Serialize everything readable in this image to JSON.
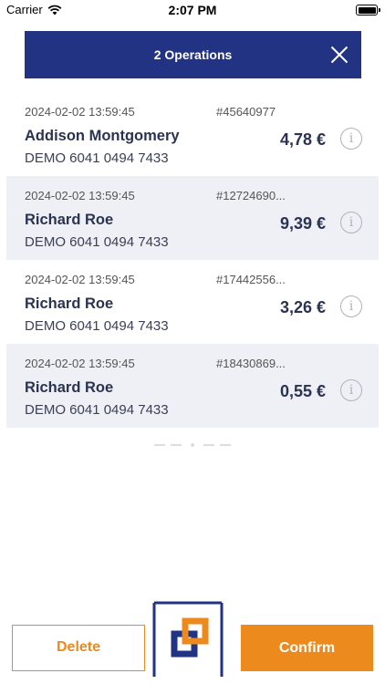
{
  "status_bar": {
    "carrier": "Carrier",
    "time": "2:07 PM"
  },
  "header": {
    "title": "2 Operations"
  },
  "operations": [
    {
      "date": "2024-02-02 13:59:45",
      "id": "#45640977",
      "name": "Addison Montgomery",
      "account": "DEMO 6041 0494 7433",
      "amount": "4,78 €"
    },
    {
      "date": "2024-02-02 13:59:45",
      "id": "#12724690...",
      "name": "Richard Roe",
      "account": "DEMO 6041 0494 7433",
      "amount": "9,39 €"
    },
    {
      "date": "2024-02-02 13:59:45",
      "id": "#17442556...",
      "name": "Richard Roe",
      "account": "DEMO 6041 0494 7433",
      "amount": "3,26 €"
    },
    {
      "date": "2024-02-02 13:59:45",
      "id": "#18430869...",
      "name": "Richard Roe",
      "account": "DEMO 6041 0494 7433",
      "amount": "0,55 €"
    }
  ],
  "info_glyph": "i",
  "actions": {
    "delete_label": "Delete",
    "confirm_label": "Confirm"
  },
  "colors": {
    "header_bg": "#223383",
    "accent": "#ec8a1e",
    "row_shade": "#eef0f6",
    "logo_blue": "#223383",
    "logo_orange": "#ec8a1e"
  },
  "icons": {
    "wifi": "wifi-icon",
    "battery": "battery-icon",
    "close": "close-icon",
    "info": "info-icon",
    "logo": "app-logo"
  }
}
